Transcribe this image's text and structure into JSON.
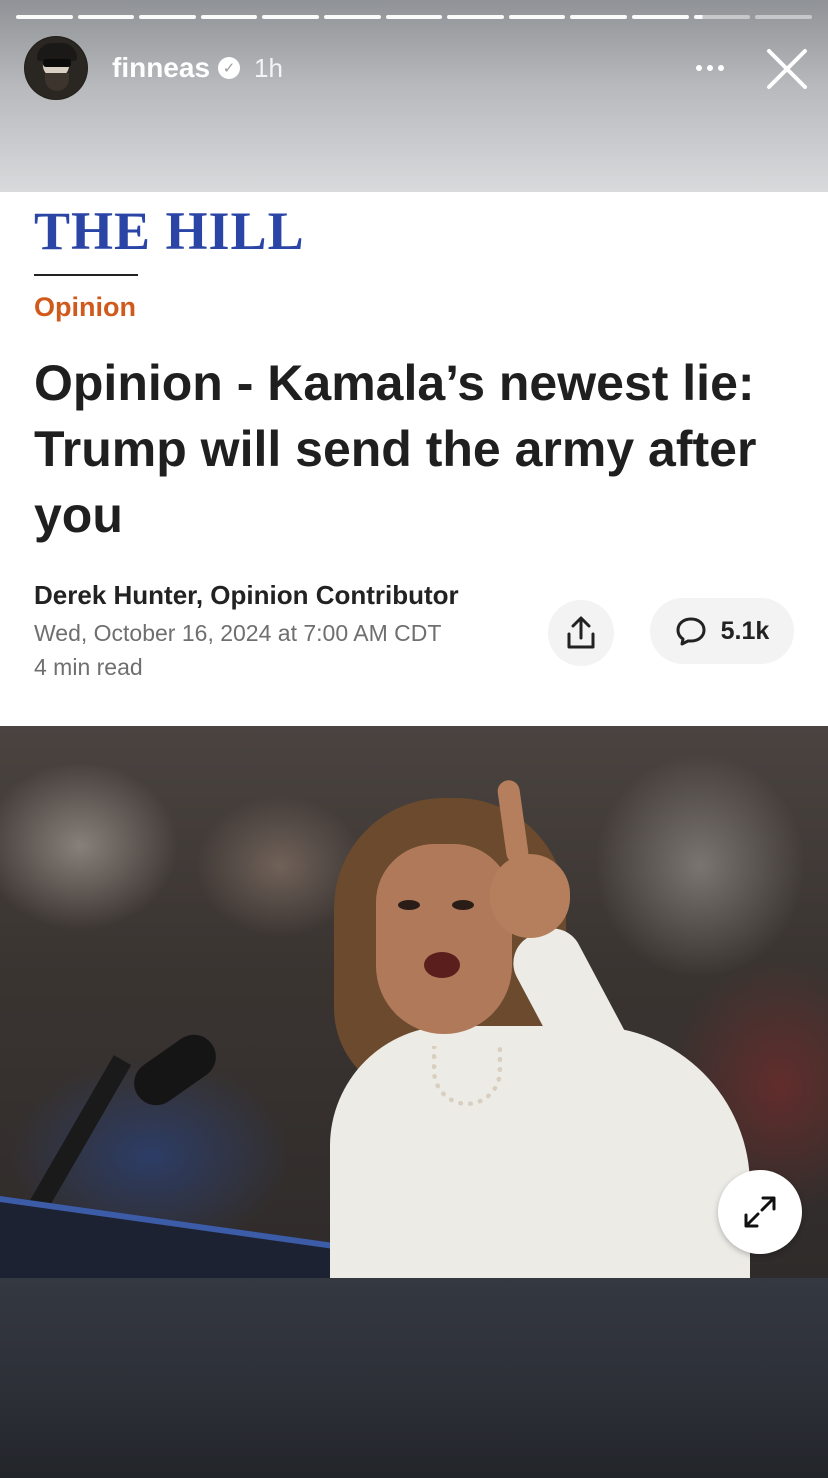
{
  "story": {
    "username": "finneas",
    "time_ago": "1h",
    "verified_icon": "verified-badge-icon",
    "progress_segments": 13,
    "current_segment": 12,
    "current_segment_progress": 0.15
  },
  "article": {
    "publication": "THE HILL",
    "section": "Opinion",
    "headline": "Opinion - Kamala’s newest lie: Trump will send the army after you",
    "byline": "Derek Hunter, Opinion Contributor",
    "date": "Wed, October 16, 2024 at 7:00 AM CDT",
    "read_time": "4 min read",
    "comments_count": "5.1k"
  },
  "colors": {
    "masthead": "#2a45a6",
    "section": "#d05a1c",
    "text": "#1f1f1f"
  },
  "icons": {
    "share": "share-icon",
    "comment": "comment-icon",
    "expand": "expand-icon",
    "more": "more-icon",
    "close": "close-icon"
  }
}
